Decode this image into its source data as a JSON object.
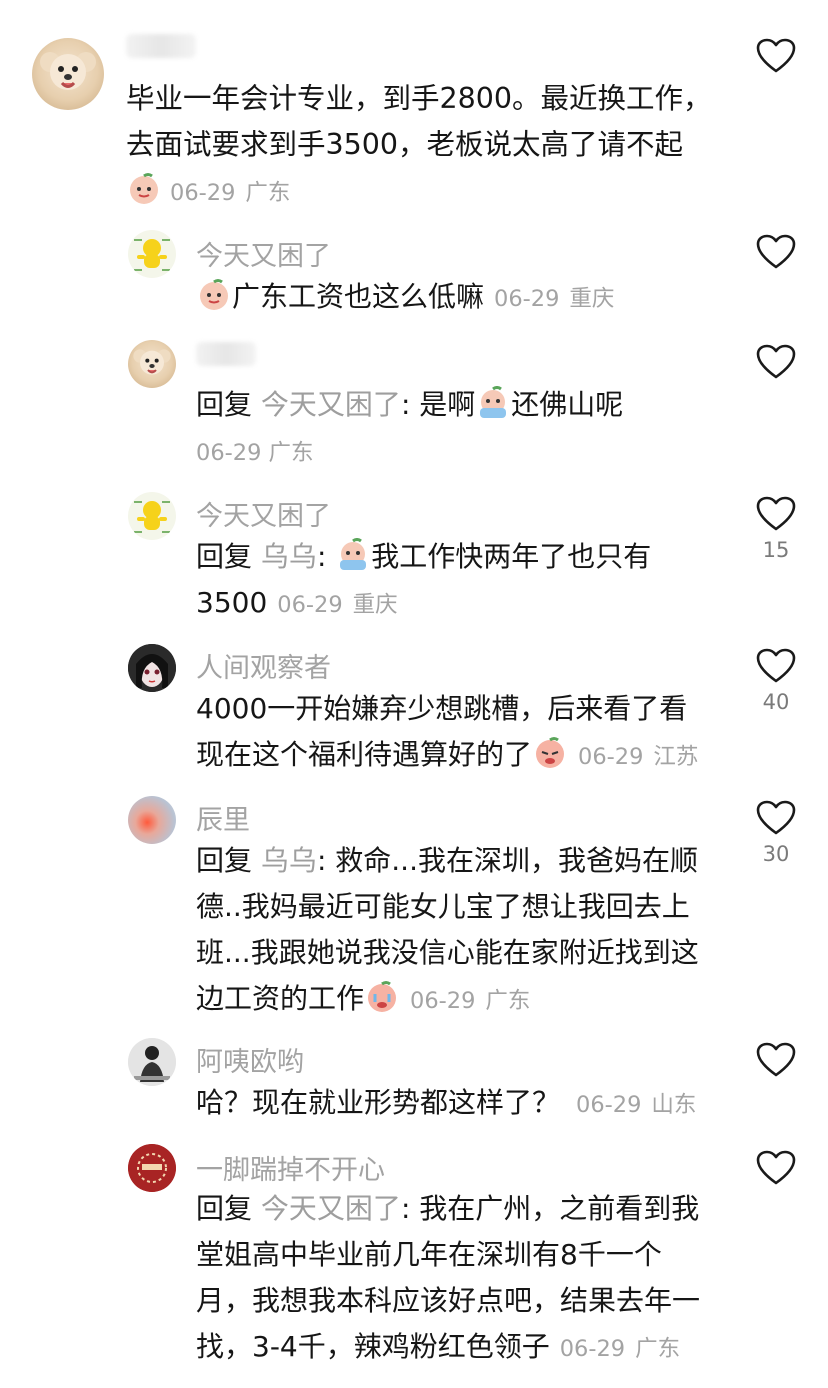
{
  "comments": [
    {
      "username": "",
      "text": "毕业一年会计专业，到手2800。最近换工作，去面试要求到手3500，老板说太高了请不起",
      "date": "06-29",
      "location": "广东",
      "likes": ""
    },
    {
      "username": "今天又困了",
      "text": "广东工资也这么低嘛",
      "date": "06-29",
      "location": "重庆",
      "likes": ""
    },
    {
      "username": "",
      "reply_prefix": "回复",
      "reply_target": "今天又困了",
      "text_before": "是啊",
      "text_after": "还佛山呢",
      "date": "06-29",
      "location": "广东",
      "likes": ""
    },
    {
      "username": "今天又困了",
      "reply_prefix": "回复",
      "reply_target": "乌乌",
      "text_line1": "我工作快两年了也只有",
      "text_line2": "3500",
      "date": "06-29",
      "location": "重庆",
      "likes": "15"
    },
    {
      "username": "人间观察者",
      "text_line1": "4000一开始嫌弃少想跳槽，后来看了看",
      "text_line2": "现在这个福利待遇算好的了",
      "date": "06-29",
      "location": "江苏",
      "likes": "40"
    },
    {
      "username": "辰里",
      "reply_prefix": "回复",
      "reply_target": "乌乌",
      "text_line1": "救命...我在深圳，我爸妈在顺",
      "text_line2": "德..我妈最近可能女儿宝了想让我回去上",
      "text_line3": "班...我跟她说我没信心能在家附近找到这",
      "text_line4": "边工资的工作",
      "date": "06-29",
      "location": "广东",
      "likes": "30"
    },
    {
      "username": "阿咦欧哟",
      "text": "哈？现在就业形势都这样了？",
      "date": "06-29",
      "location": "山东",
      "likes": ""
    },
    {
      "username": "一脚踹掉不开心",
      "reply_prefix": "回复",
      "reply_target": "今天又困了",
      "text_line1": "我在广州，之前看到我",
      "text_line2": "堂姐高中毕业前几年在深圳有8千一个",
      "text_line3": "月，我想我本科应该好点吧，结果去年一",
      "text_line4": "找，3-4千，辣鸡粉红色领子",
      "date": "06-29",
      "location": "广东",
      "likes": ""
    }
  ],
  "icons": {
    "like": "heart-outline-icon",
    "emoji": "peach-face-emoji"
  },
  "colors": {
    "text": "#161616",
    "muted": "#a3a3a3",
    "reply_target": "#9e9e9e",
    "icon": "#1a1a1a"
  }
}
